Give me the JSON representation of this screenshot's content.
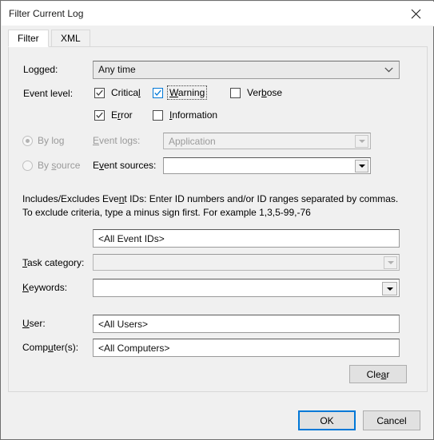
{
  "window": {
    "title": "Filter Current Log",
    "close_icon": "close-icon"
  },
  "tabs": [
    {
      "label": "Filter",
      "active": true
    },
    {
      "label": "XML",
      "active": false
    }
  ],
  "form": {
    "logged": {
      "label": "Logged:",
      "value": "Any time",
      "enabled": true,
      "icon": "chevron-down-icon"
    },
    "event_level": {
      "label": "Event level:",
      "checkboxes": [
        {
          "name": "critical",
          "label": "Critical",
          "accel": "l",
          "checked": true,
          "focused": false
        },
        {
          "name": "warning",
          "label": "Warning",
          "accel": "W",
          "checked": true,
          "focused": true
        },
        {
          "name": "verbose",
          "label": "Verbose",
          "accel": "b",
          "checked": false,
          "focused": false
        },
        {
          "name": "error",
          "label": "Error",
          "accel": "r",
          "checked": true,
          "focused": false
        },
        {
          "name": "information",
          "label": "Information",
          "accel": "I",
          "checked": false,
          "focused": false
        }
      ]
    },
    "scope": {
      "by_log": {
        "label": "By log",
        "accel": "g",
        "selected": true,
        "enabled": false
      },
      "by_source": {
        "label": "By source",
        "accel": "s",
        "selected": false,
        "enabled": false
      }
    },
    "event_logs": {
      "label": "Event logs:",
      "accel": "E",
      "value": "Application",
      "enabled": false,
      "icon": "dropdown-arrow-icon"
    },
    "event_sources": {
      "label": "Event sources:",
      "accel": "v",
      "value": "",
      "enabled": true,
      "icon": "dropdown-arrow-icon"
    },
    "event_ids_help": "Includes/Excludes Event IDs: Enter ID numbers and/or ID ranges separated by commas. To exclude criteria, type a minus sign first. For example 1,3,5-99,-76",
    "event_ids": {
      "value": "<All Event IDs>",
      "enabled": true
    },
    "task_category": {
      "label": "Task category:",
      "accel": "T",
      "value": "",
      "enabled": false,
      "icon": "dropdown-arrow-icon"
    },
    "keywords": {
      "label": "Keywords:",
      "accel": "K",
      "value": "",
      "enabled": true,
      "icon": "dropdown-arrow-icon"
    },
    "user": {
      "label": "User:",
      "accel": "U",
      "value": "<All Users>",
      "enabled": true
    },
    "computers": {
      "label": "Computer(s):",
      "accel": "u",
      "value": "<All Computers>",
      "enabled": true
    },
    "clear_button": {
      "label": "Clear",
      "accel": "a"
    }
  },
  "footer": {
    "ok_label": "OK",
    "cancel_label": "Cancel"
  },
  "colors": {
    "accent": "#0078d7",
    "dialog_bg": "#f0f0f0",
    "titlebar_bg": "#ffffff",
    "field_bg": "#ffffff",
    "disabled_text": "#9a9a9a"
  }
}
